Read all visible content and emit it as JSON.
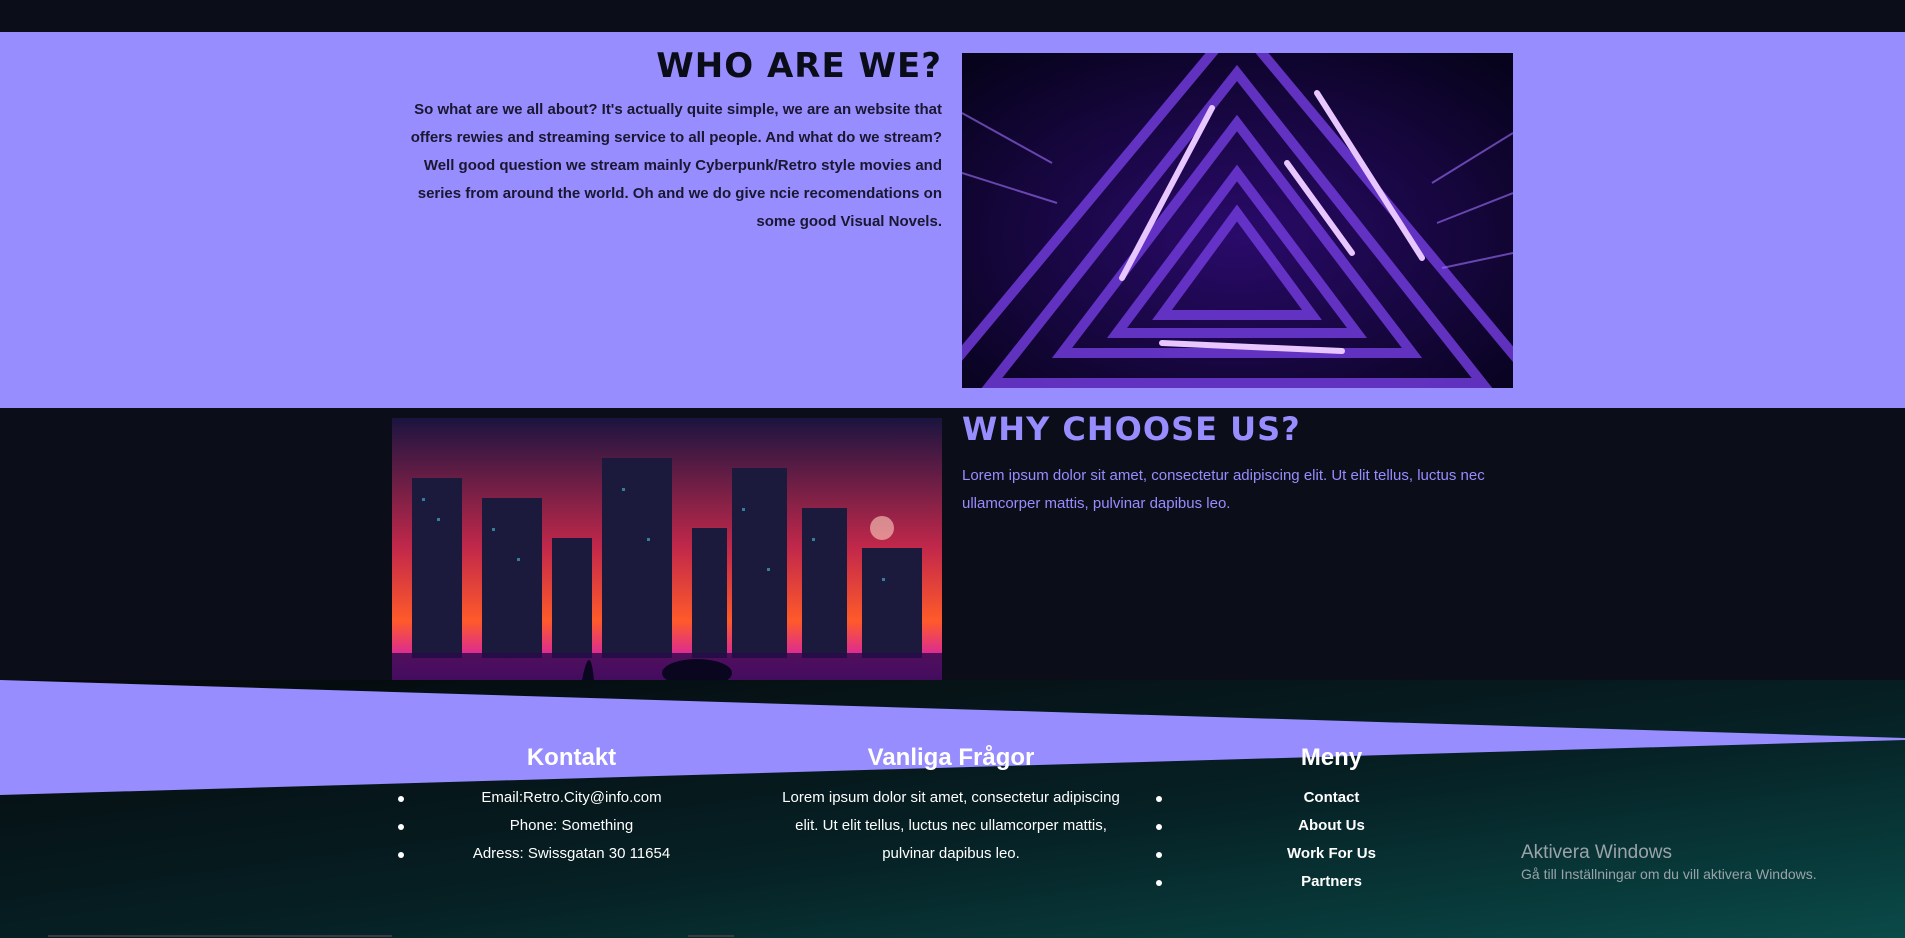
{
  "about": {
    "title": "Who are we?",
    "text": "So what are we all about? It's actually quite simple, we are an website that offers rewies and streaming service to all people. And what do we stream? Well good question we stream mainly Cyberpunk/Retro style movies and series from around the world. Oh and we do give ncie recomendations on some good Visual Novels."
  },
  "why": {
    "title": "Why choose us?",
    "text": "Lorem ipsum dolor sit amet, consectetur adipiscing elit. Ut elit tellus, luctus nec ullamcorper mattis, pulvinar dapibus leo."
  },
  "footer": {
    "kontakt": {
      "title": "Kontakt",
      "items": [
        "Email:Retro.City@info.com",
        "Phone: Something",
        "Adress: Swissgatan 30 11654"
      ]
    },
    "faq": {
      "title": "Vanliga Frågor",
      "text": "Lorem ipsum dolor sit amet, consectetur adipiscing elit. Ut elit tellus, luctus nec ullamcorper mattis, pulvinar dapibus leo."
    },
    "meny": {
      "title": "Meny",
      "items": [
        "Contact",
        "About Us",
        "Work For Us",
        "Partners"
      ]
    }
  },
  "watermark": {
    "line1": "Aktivera Windows",
    "line2": "Gå till Inställningar om du vill aktivera Windows."
  },
  "colors": {
    "lavender": "#978dff",
    "dark": "#0b0d18",
    "teal": "#0c4a4a"
  }
}
